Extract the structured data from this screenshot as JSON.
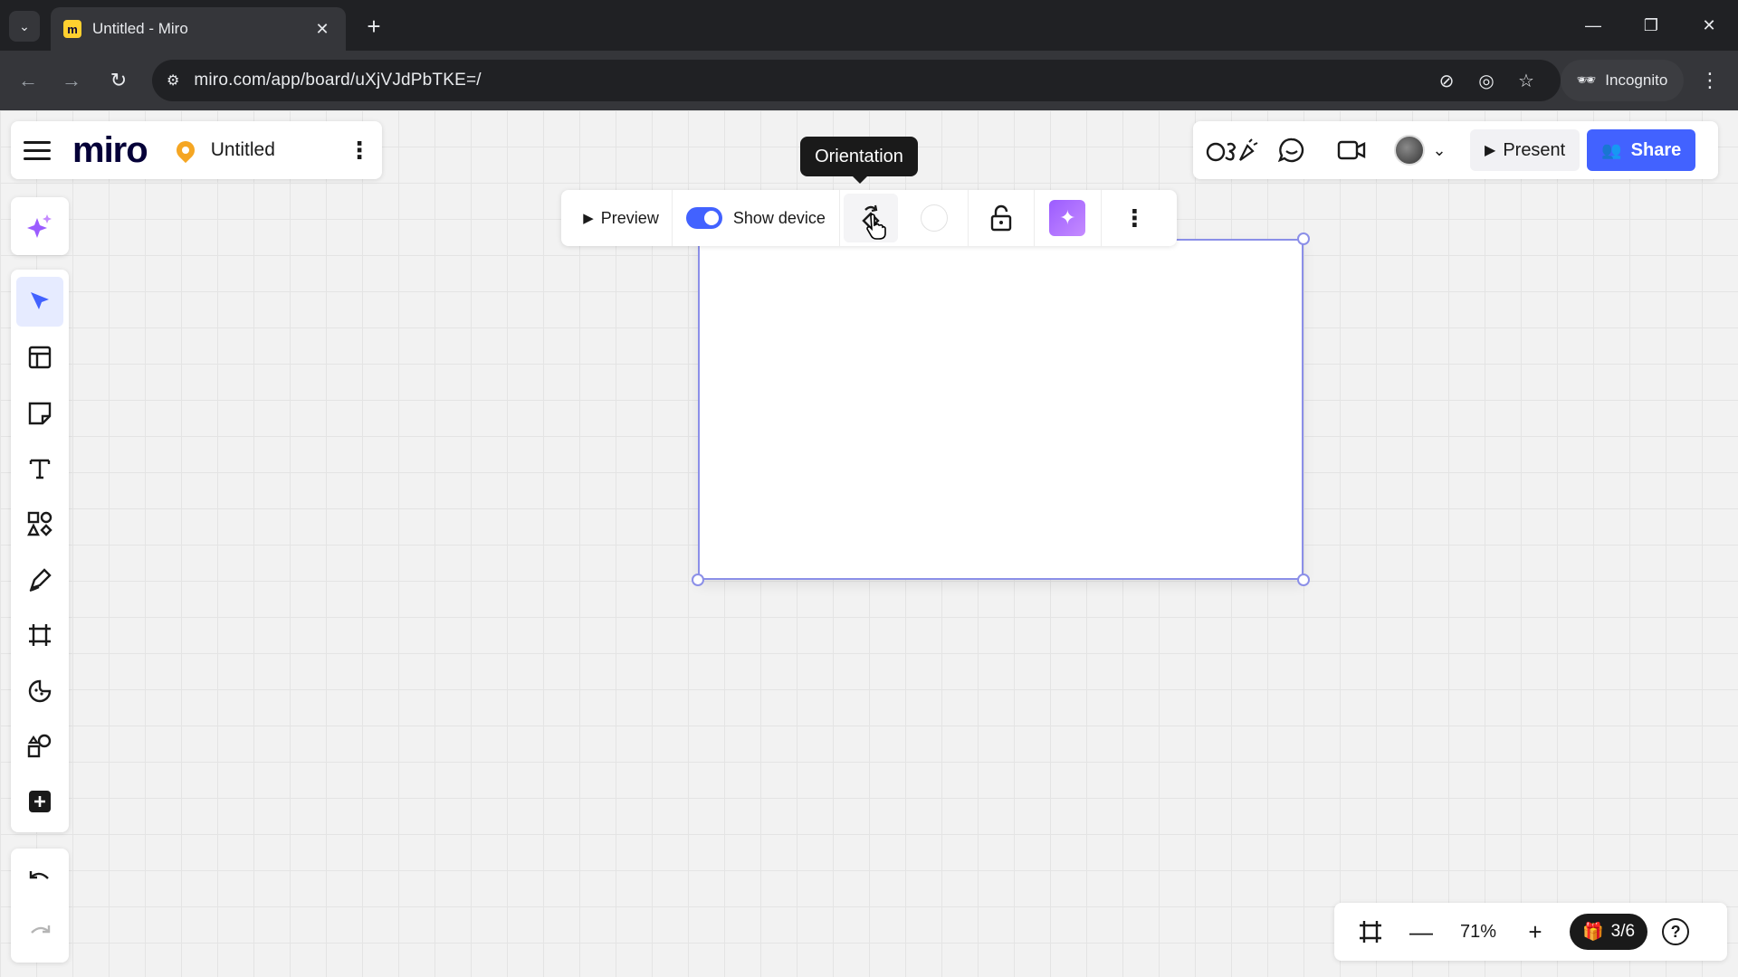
{
  "browser": {
    "tab_title": "Untitled - Miro",
    "tab_favicon": "miro-favicon",
    "url": "miro.com/app/board/uXjVJdPbTKE=/",
    "incognito_label": "Incognito"
  },
  "board": {
    "logo": "miro",
    "title": "Untitled"
  },
  "top_right": {
    "present_label": "Present",
    "share_label": "Share"
  },
  "left_tools": [
    "select-tool",
    "templates-tool",
    "sticky-note-tool",
    "text-tool",
    "shapes-tool",
    "pen-tool",
    "frame-tool",
    "stickers-tool",
    "diagram-tool",
    "more-apps-tool"
  ],
  "context_toolbar": {
    "preview_label": "Preview",
    "show_device_label": "Show device",
    "show_device_on": true
  },
  "tooltip": {
    "text": "Orientation"
  },
  "zoom": {
    "level": "71%",
    "pages": "3/6"
  },
  "colors": {
    "accent": "#4262ff",
    "frame_selection": "#8b8fe8",
    "ai_purple": "#9b5cff"
  }
}
